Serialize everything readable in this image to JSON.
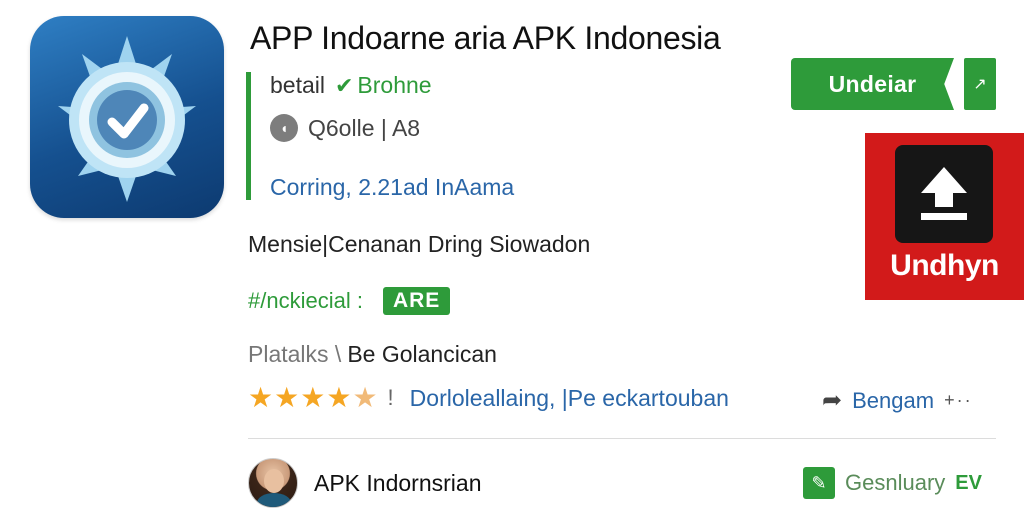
{
  "app": {
    "title": "APP Indoarne aria APK Indonesia",
    "detail_label": "betail",
    "detail_tag": "Brohne",
    "meta_text": "Q6olle | A8",
    "coming_text": "Corring, 2.21ad InAama",
    "description": "Mensie|Cenanan Dring Siowadon",
    "category_label": "#/nckiecial :",
    "category_badge": "ARE",
    "platform_label": "Platalks \\",
    "platform_value": "Be Golancican",
    "rating_stars": 4.5,
    "rating_sep": "!",
    "rating_text": "Dorloleallaing, |Pe eckartouban",
    "share_label": "Bengam",
    "more_glyph": "+··"
  },
  "actions": {
    "install_label": "Undeiar",
    "install_more_glyph": "↗",
    "download_label": "Undhyn"
  },
  "author": {
    "name": "APK Indornsrian"
  },
  "genre": {
    "label": "Gesnluary",
    "suffix": "EV"
  },
  "icons": {
    "app_icon": "shield-check-icon",
    "detail_check": "check-badge-icon",
    "meta_icon": "circle-icon",
    "share": "share-arrow-icon",
    "download": "upload-arrow-icon",
    "genre": "edit-badge-icon"
  },
  "colors": {
    "accent_green": "#2e9b3a",
    "link_blue": "#2a66a8",
    "download_red": "#d21a1a",
    "star": "#f5a623"
  }
}
